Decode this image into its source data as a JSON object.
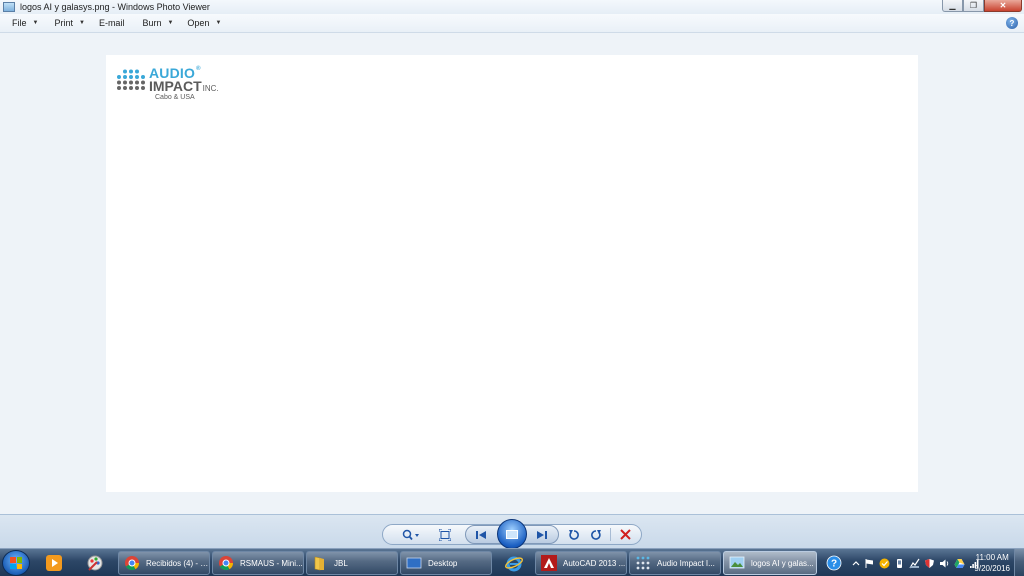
{
  "window": {
    "title": "logos AI y galasys.png - Windows Photo Viewer",
    "controls": {
      "minimize": "▁",
      "maximize": "❐",
      "close": "✕"
    }
  },
  "menu": {
    "items": [
      {
        "label": "File",
        "has_dropdown": true
      },
      {
        "label": "Print",
        "has_dropdown": true
      },
      {
        "label": "E-mail",
        "has_dropdown": false
      },
      {
        "label": "Burn",
        "has_dropdown": true
      },
      {
        "label": "Open",
        "has_dropdown": true
      }
    ],
    "help": "?"
  },
  "photo": {
    "logo": {
      "line1": "AUDIO",
      "registered": "®",
      "line2": "IMPACT",
      "suffix": "INC.",
      "tagline": "Cabo & USA",
      "brand_blue": "#3aa8d8",
      "brand_gray": "#5b5b5b"
    }
  },
  "controls": {
    "icons": [
      "zoom-icon",
      "actual-size-icon",
      "previous-icon",
      "slideshow-icon",
      "next-icon",
      "rotate-counterclockwise-icon",
      "rotate-clockwise-icon",
      "delete-icon"
    ]
  },
  "taskbar": {
    "start": "start-icon",
    "pinned": [
      "media-player-icon",
      "paint-tools-icon"
    ],
    "buttons": [
      {
        "label": "Recibidos (4) - F...",
        "icon": "chrome-icon"
      },
      {
        "label": "RSMAUS - Mini...",
        "icon": "chrome-icon"
      },
      {
        "label": "JBL",
        "icon": "folder-icon"
      },
      {
        "label": "Desktop",
        "icon": "desktop-icon"
      },
      {
        "label": "",
        "icon": "internet-explorer-icon"
      },
      {
        "label": "AutoCAD 2013 ...",
        "icon": "autocad-icon"
      },
      {
        "label": "Audio Impact I...",
        "icon": "audio-impact-icon"
      },
      {
        "label": "logos AI y galas...",
        "icon": "photo-viewer-icon",
        "active": true
      }
    ],
    "clock": {
      "time": "11:00 AM",
      "date": "9/20/2016"
    }
  }
}
